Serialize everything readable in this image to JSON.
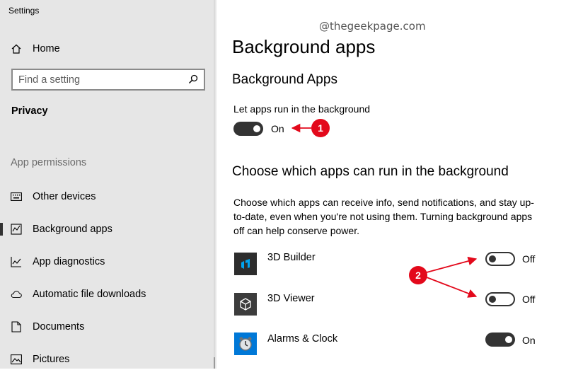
{
  "window": {
    "title": "Settings"
  },
  "sidebar": {
    "home_label": "Home",
    "search_placeholder": "Find a setting",
    "section_title": "Privacy",
    "group_label": "App permissions",
    "items": [
      {
        "label": "Other devices",
        "icon": "keyboard-icon"
      },
      {
        "label": "Background apps",
        "icon": "background-apps-icon",
        "active": true
      },
      {
        "label": "App diagnostics",
        "icon": "chart-icon"
      },
      {
        "label": "Automatic file downloads",
        "icon": "cloud-icon"
      },
      {
        "label": "Documents",
        "icon": "document-icon"
      },
      {
        "label": "Pictures",
        "icon": "picture-icon"
      }
    ]
  },
  "content": {
    "watermark": "@thegeekpage.com",
    "page_title": "Background apps",
    "section_heading": "Background Apps",
    "let_apps_label": "Let apps run in the background",
    "let_apps_state": "On",
    "choose_heading": "Choose which apps can run in the background",
    "choose_desc": "Choose which apps can receive info, send notifications, and stay up-to-date, even when you're not using them. Turning background apps off can help conserve power.",
    "apps": [
      {
        "name": "3D Builder",
        "state": "Off",
        "icon": "3d-builder-icon",
        "icon_color": "#2d2d2d"
      },
      {
        "name": "3D Viewer",
        "state": "Off",
        "icon": "3d-viewer-icon",
        "icon_color": "#3c3c3c"
      },
      {
        "name": "Alarms & Clock",
        "state": "On",
        "icon": "alarm-clock-icon",
        "icon_color": "#0078d7"
      }
    ]
  },
  "annotations": {
    "badge1": "1",
    "badge2": "2",
    "color": "#e3091b"
  }
}
